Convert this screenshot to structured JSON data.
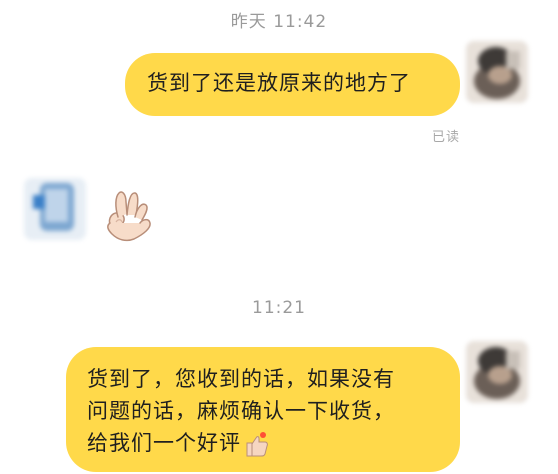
{
  "conversation": {
    "timestamp_1": "昨天 11:42",
    "message_1": "货到了还是放原来的地方了",
    "read_status": "已读",
    "timestamp_2": "11:21",
    "message_2_line_1": "货到了，您收到的话，如果没有",
    "message_2_line_2": "问题的话，麻烦确认一下收货，",
    "message_2_line_3": "给我们一个好评"
  },
  "colors": {
    "bubble": "#ffd94a",
    "timestamp": "#9a9a9a",
    "read_receipt": "#a8a8a8"
  },
  "icons": {
    "reaction": "ok-hand-emoji",
    "message_2_suffix": "thumbs-up-emoji"
  }
}
